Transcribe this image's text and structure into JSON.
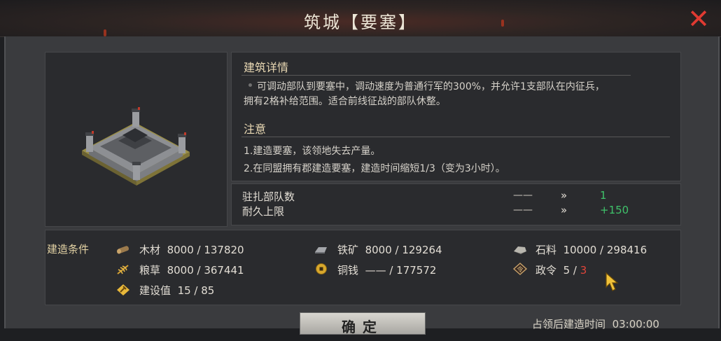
{
  "window": {
    "title": "筑城【要塞】",
    "close": "✕"
  },
  "details": {
    "heading": "建筑详情",
    "lines": [
      "可调动部队到要塞中，调动速度为普通行军的300%，并允许1支部队在内征兵，",
      "拥有2格补给范围。适合前线征战的部队休整。"
    ]
  },
  "notes": {
    "heading": "注意",
    "items": [
      "1.建造要塞，该领地失去产量。",
      "2.在同盟拥有郡建造要塞，建造时间缩短1/3（变为3小时）。"
    ]
  },
  "stats": [
    {
      "label": "驻扎部队数",
      "old": "——",
      "arrow": "»",
      "new": "1"
    },
    {
      "label": "耐久上限",
      "old": "——",
      "arrow": "»",
      "new": "+150"
    }
  ],
  "conditions": {
    "title": "建造条件",
    "wood": {
      "name": "木材",
      "value": "8000 / 137820",
      "icon": "wood-log-icon"
    },
    "iron": {
      "name": "铁矿",
      "value": "8000 / 129264",
      "icon": "iron-ingot-icon"
    },
    "stone": {
      "name": "石料",
      "value": "10000 / 298416",
      "icon": "stone-icon"
    },
    "grain": {
      "name": "粮草",
      "value": "8000 / 367441",
      "icon": "grain-icon"
    },
    "copper": {
      "name": "铜钱",
      "value": "—— / 177572",
      "icon": "coin-icon"
    },
    "order": {
      "name": "政令",
      "have": "5",
      "sep": " / ",
      "need": "3",
      "icon": "order-token-icon"
    },
    "build": {
      "name": "建设值",
      "value": "15 / 85",
      "icon": "hammer-icon"
    }
  },
  "footer": {
    "confirm": "确定",
    "time_label": "占领后建造时间",
    "time_value": "03:00:00"
  },
  "colors": {
    "accent_green": "#3fc26a",
    "warning_red": "#e0453a",
    "heading_gold": "#e9d9b4"
  }
}
